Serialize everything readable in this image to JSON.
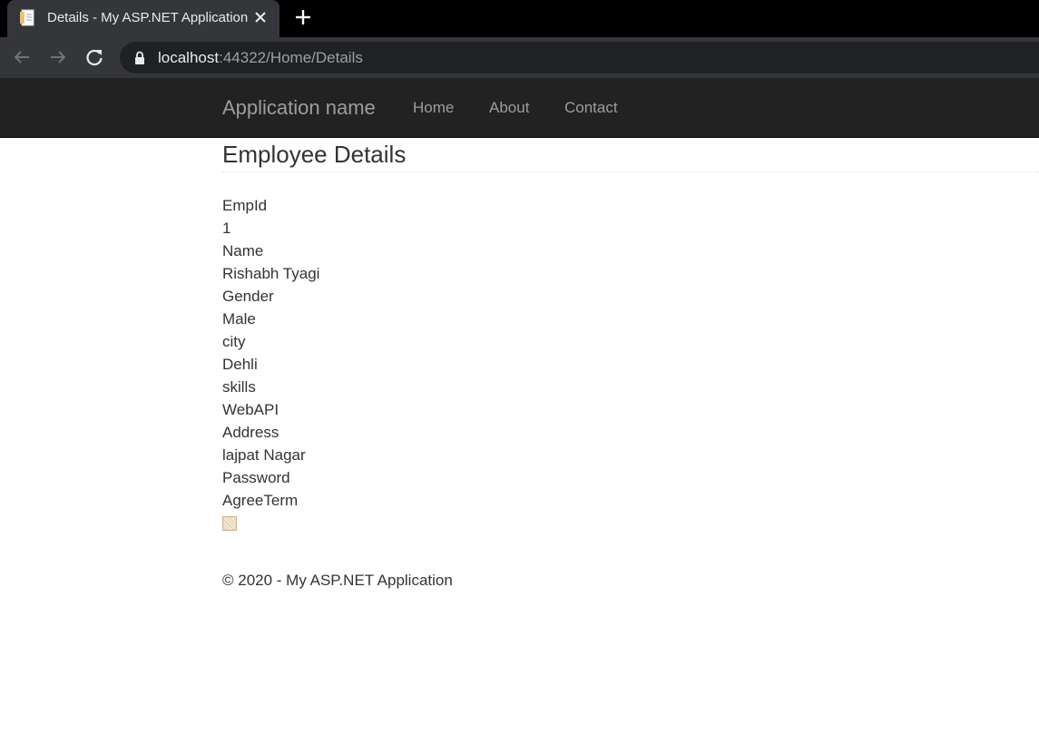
{
  "browser": {
    "tab_title": "Details - My ASP.NET Application",
    "url_host": "localhost",
    "url_rest": ":44322/Home/Details"
  },
  "navbar": {
    "brand": "Application name",
    "links": [
      "Home",
      "About",
      "Contact"
    ]
  },
  "page": {
    "title": "Employee Details",
    "fields": [
      {
        "label": "EmpId",
        "value": "1"
      },
      {
        "label": "Name",
        "value": "Rishabh Tyagi"
      },
      {
        "label": "Gender",
        "value": "Male"
      },
      {
        "label": "city",
        "value": "Dehli"
      },
      {
        "label": "skills",
        "value": "WebAPI"
      },
      {
        "label": "Address",
        "value": "lajpat Nagar"
      },
      {
        "label": "Password",
        "value": ""
      },
      {
        "label": "AgreeTerm",
        "checked": true
      }
    ]
  },
  "footer": {
    "text": "© 2020 - My ASP.NET Application"
  },
  "colors": {
    "tabstrip": "#000000",
    "toolbar": "#35363a",
    "omnibox": "#202124",
    "navbar": "#222222",
    "navbar_text": "#9d9d9d",
    "body_text": "#333333"
  },
  "icons": {
    "favicon": "page-favicon-icon",
    "close": "close-icon",
    "new_tab": "plus-icon",
    "back": "arrow-left-icon",
    "forward": "arrow-right-icon",
    "reload": "reload-icon",
    "lock": "lock-icon"
  }
}
